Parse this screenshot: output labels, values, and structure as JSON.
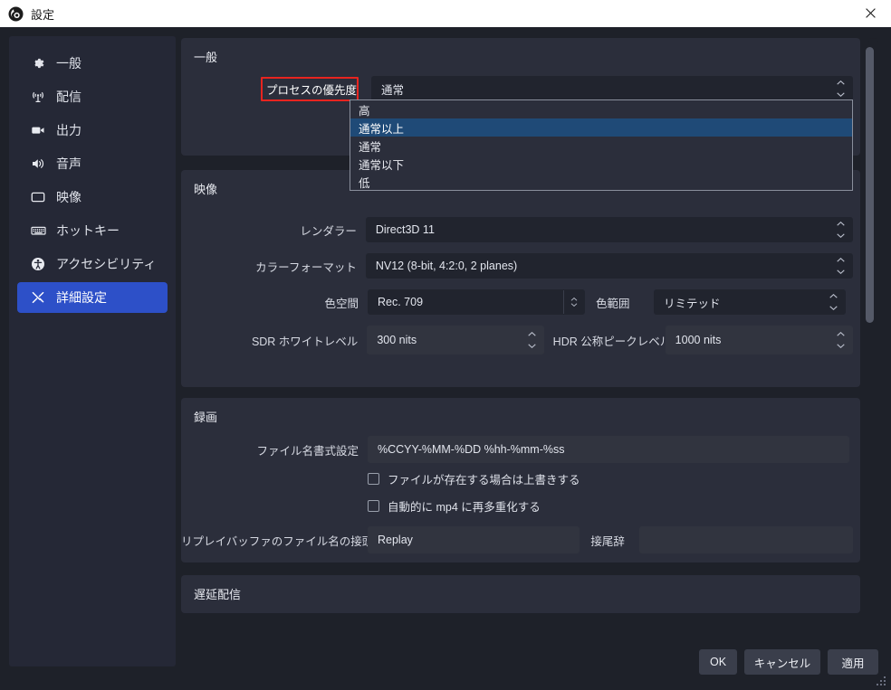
{
  "window": {
    "title": "設定",
    "logo_icon": "obs-logo-icon",
    "close_icon": "close-icon"
  },
  "sidebar": {
    "items": [
      {
        "label": "一般",
        "icon": "gear-icon",
        "active": false
      },
      {
        "label": "配信",
        "icon": "broadcast-icon",
        "active": false
      },
      {
        "label": "出力",
        "icon": "camera-icon",
        "active": false
      },
      {
        "label": "音声",
        "icon": "speaker-icon",
        "active": false
      },
      {
        "label": "映像",
        "icon": "monitor-icon",
        "active": false
      },
      {
        "label": "ホットキー",
        "icon": "keyboard-icon",
        "active": false
      },
      {
        "label": "アクセシビリティ",
        "icon": "accessibility-icon",
        "active": false
      },
      {
        "label": "詳細設定",
        "icon": "tools-icon",
        "active": true
      }
    ]
  },
  "general_group": {
    "title": "一般",
    "process_priority": {
      "label": "プロセスの優先度",
      "value": "通常",
      "spinner_icon": "chevron-updown-icon",
      "options": [
        "高",
        "通常以上",
        "通常",
        "通常以下",
        "低"
      ],
      "highlighted_option": "通常以上"
    }
  },
  "video_group": {
    "title": "映像",
    "renderer": {
      "label": "レンダラー",
      "value": "Direct3D 11",
      "spinner_icon": "chevron-updown-icon"
    },
    "color_format": {
      "label": "カラーフォーマット",
      "value": "NV12 (8-bit, 4:2:0, 2 planes)",
      "spinner_icon": "chevron-updown-icon"
    },
    "color_space": {
      "label": "色空間",
      "value": "Rec. 709",
      "spinner_icon": "chevron-updown-icon"
    },
    "color_range": {
      "label": "色範囲",
      "value": "リミテッド",
      "spinner_icon": "chevron-updown-icon"
    },
    "sdr_white_level": {
      "label": "SDR ホワイトレベル",
      "value": "300 nits",
      "spinner_icon": "chevron-updown-icon"
    },
    "hdr_peak_level": {
      "label": "HDR 公称ピークレベル",
      "value": "1000 nits",
      "spinner_icon": "chevron-updown-icon"
    }
  },
  "recording_group": {
    "title": "録画",
    "filename_format": {
      "label": "ファイル名書式設定",
      "value": "%CCYY-%MM-%DD %hh-%mm-%ss"
    },
    "overwrite_checkbox": {
      "label": "ファイルが存在する場合は上書きする",
      "checked": false
    },
    "remux_checkbox": {
      "label": "自動的に mp4 に再多重化する",
      "checked": false
    },
    "replay_prefix": {
      "label": "リプレイバッファのファイル名の接頭辞",
      "value": "Replay"
    },
    "replay_suffix": {
      "label": "接尾辞",
      "value": ""
    }
  },
  "delay_group": {
    "title": "遅延配信"
  },
  "footer": {
    "ok_label": "OK",
    "cancel_label": "キャンセル",
    "apply_label": "適用",
    "resize_grip_icon": "resize-grip-icon"
  },
  "colors": {
    "accent": "#2d50c8",
    "highlight": "#1f4a77",
    "redbox": "#e8241f",
    "panel": "#2b2e3b",
    "window": "#1e2129"
  }
}
